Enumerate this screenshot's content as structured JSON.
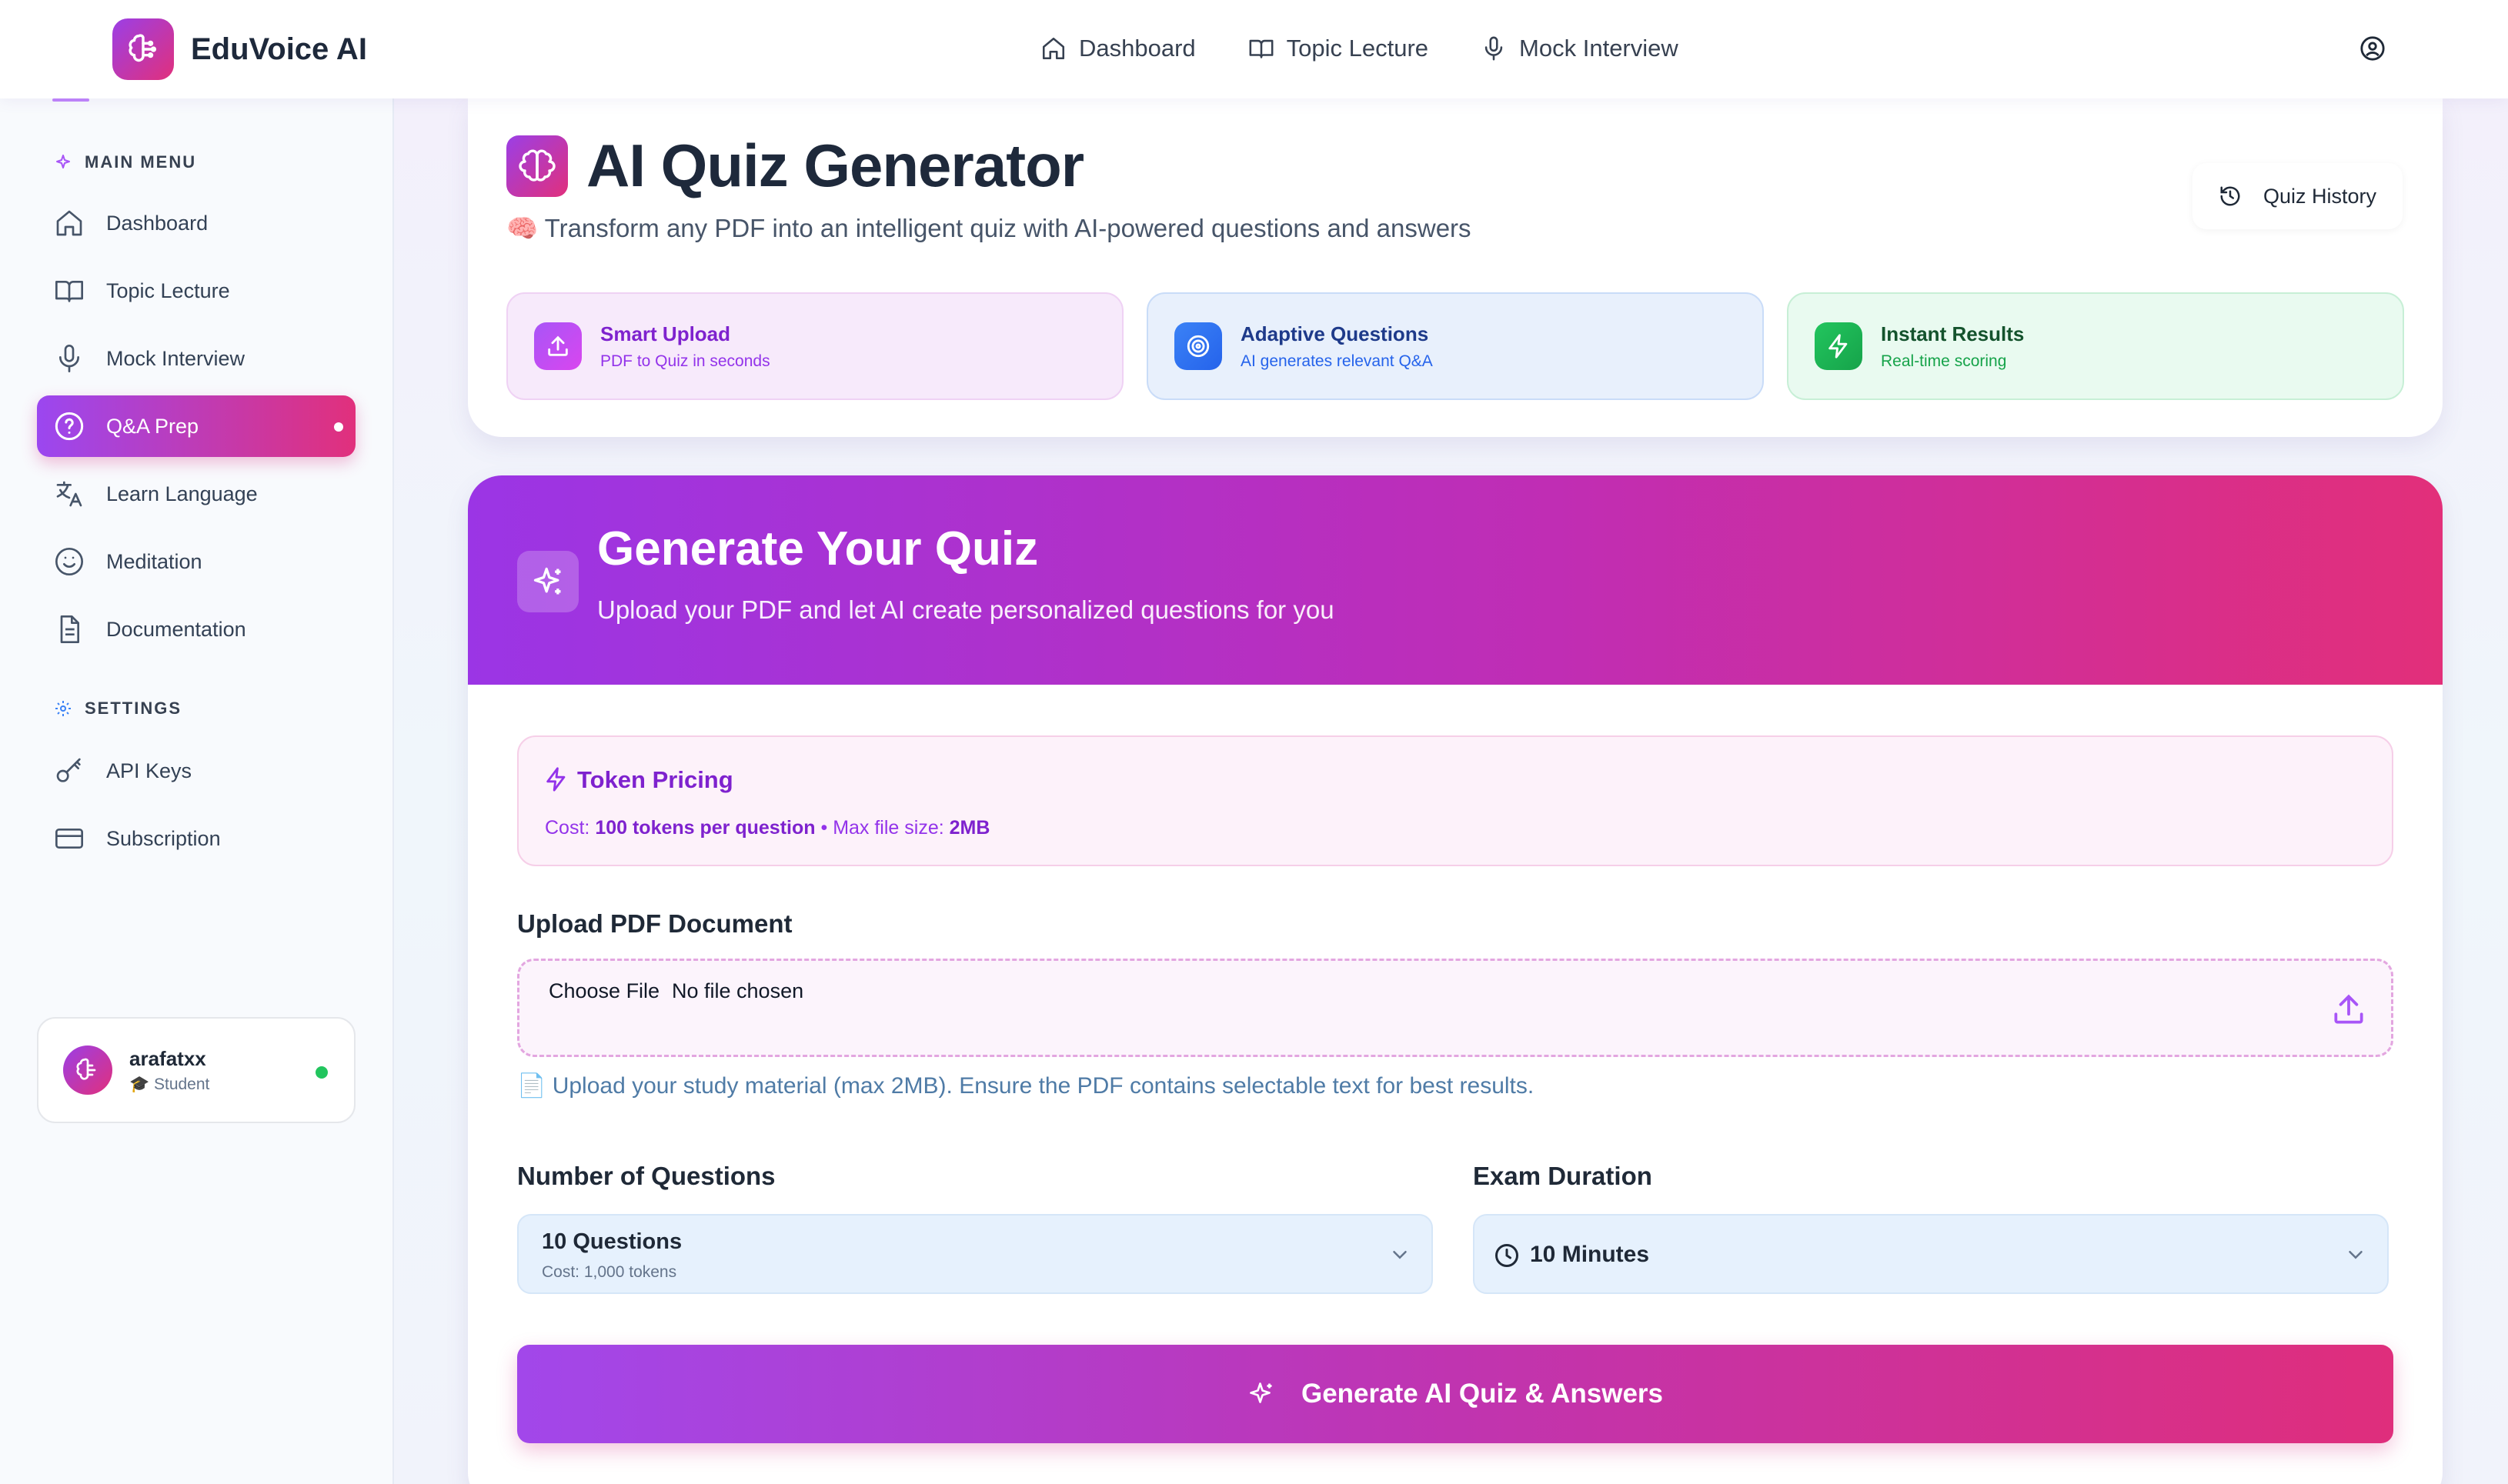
{
  "brand": {
    "name": "EduVoice AI"
  },
  "topnav": [
    {
      "label": "Dashboard",
      "icon": "home-icon"
    },
    {
      "label": "Topic Lecture",
      "icon": "book-open-icon"
    },
    {
      "label": "Mock Interview",
      "icon": "microphone-icon"
    }
  ],
  "sidebar": {
    "main_menu_title": "MAIN MENU",
    "settings_title": "SETTINGS",
    "items": [
      {
        "label": "Dashboard",
        "icon": "home-icon"
      },
      {
        "label": "Topic Lecture",
        "icon": "book-open-icon"
      },
      {
        "label": "Mock Interview",
        "icon": "microphone-icon"
      },
      {
        "label": "Q&A Prep",
        "icon": "help-circle-icon",
        "active": true
      },
      {
        "label": "Learn Language",
        "icon": "translate-icon"
      },
      {
        "label": "Meditation",
        "icon": "smile-icon"
      },
      {
        "label": "Documentation",
        "icon": "document-icon"
      }
    ],
    "settings_items": [
      {
        "label": "API Keys",
        "icon": "key-icon"
      },
      {
        "label": "Subscription",
        "icon": "credit-card-icon"
      }
    ],
    "user": {
      "name": "arafatxx",
      "role": "🎓 Student",
      "status_color": "#22c55e"
    }
  },
  "header": {
    "title": "AI Quiz Generator",
    "subtitle": "🧠 Transform any PDF into an intelligent quiz with AI-powered questions and answers",
    "history_button": "Quiz History",
    "features": [
      {
        "title": "Smart Upload",
        "subtitle": "PDF to Quiz in seconds",
        "icon": "upload-icon"
      },
      {
        "title": "Adaptive Questions",
        "subtitle": "AI generates relevant Q&A",
        "icon": "target-icon"
      },
      {
        "title": "Instant Results",
        "subtitle": "Real-time scoring",
        "icon": "lightning-icon"
      }
    ]
  },
  "generator": {
    "title": "Generate Your Quiz",
    "subtitle": "Upload your PDF and let AI create personalized questions for you",
    "pricing": {
      "title": "Token Pricing",
      "cost_label": "Cost:",
      "cost_value": "100 tokens per question",
      "separator": "•",
      "max_label": "Max file size:",
      "max_value": "2MB"
    },
    "upload": {
      "label": "Upload PDF Document",
      "button": "Choose File",
      "status": "No file chosen",
      "hint": "📄 Upload your study material (max 2MB). Ensure the PDF contains selectable text for best results."
    },
    "questions": {
      "label": "Number of Questions",
      "value": "10 Questions",
      "cost": "Cost: 1,000 tokens"
    },
    "duration": {
      "label": "Exam Duration",
      "value": "10 Minutes"
    },
    "submit": "Generate AI Quiz & Answers"
  },
  "colors": {
    "accent_start": "#9b3fe6",
    "accent_end": "#e1307c",
    "green": "#22c55e",
    "blue": "#3b82f6"
  }
}
